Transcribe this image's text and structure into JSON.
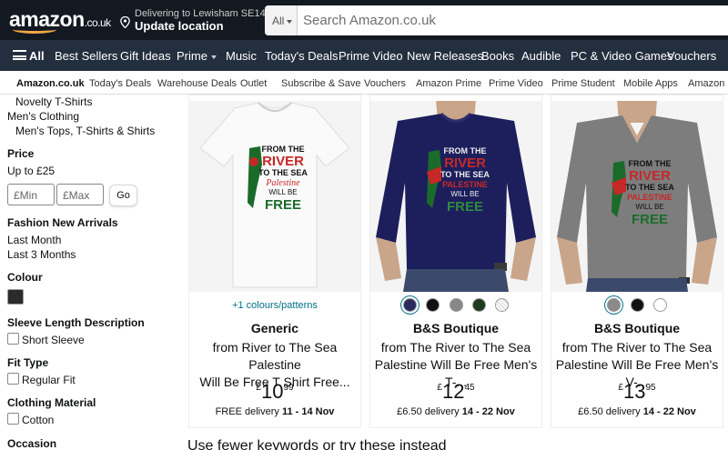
{
  "header": {
    "logo_text": "amazon",
    "logo_tld": ".co.uk",
    "deliver_line1": "Delivering to Lewisham SE14",
    "deliver_line2": "Update location",
    "search_category": "All",
    "search_placeholder": "Search Amazon.co.uk"
  },
  "nav": {
    "all_label": "All",
    "items": [
      "Best Sellers",
      "Gift Ideas",
      "Prime",
      "Music",
      "Today's Deals",
      "Prime Video",
      "New Releases",
      "Books",
      "Audible",
      "PC & Video Games",
      "Vouchers"
    ]
  },
  "subnav": {
    "items": [
      "Amazon.co.uk",
      "Today's Deals",
      "Warehouse Deals",
      "Outlet",
      "Subscribe & Save",
      "Vouchers",
      "Amazon Prime",
      "Prime Video",
      "Prime Student",
      "Mobile Apps",
      "Amazon P"
    ]
  },
  "sidebar": {
    "cat_novelty": "Novelty T-Shirts",
    "cat_clothing": "Men's Clothing",
    "cat_tops": "Men's Tops, T-Shirts & Shirts",
    "price_head": "Price",
    "price_upto": "Up to £25",
    "min_placeholder": "£Min",
    "max_placeholder": "£Max",
    "go_label": "Go",
    "fashion_head": "Fashion New Arrivals",
    "last_month": "Last Month",
    "last_3_months": "Last 3 Months",
    "colour_head": "Colour",
    "sleeve_head": "Sleeve Length Description",
    "short_sleeve": "Short Sleeve",
    "fit_head": "Fit Type",
    "regular_fit": "Regular Fit",
    "material_head": "Clothing Material",
    "cotton": "Cotton",
    "occasion_head": "Occasion"
  },
  "products": [
    {
      "colours_link": "+1 colours/patterns",
      "brand": "Generic",
      "title_l1": "from River to The Sea Palestine",
      "title_l2": "Will Be Free T Shirt Free...",
      "price_symbol": "£",
      "price_whole": "10",
      "price_fraction": "99",
      "delivery_text": "FREE delivery ",
      "delivery_dates": "11 - 14 Nov",
      "shirt_color": "#f7f7f7",
      "print_lines": [
        "FROM THE",
        "RIVER",
        "TO THE SEA",
        "Palestine",
        "WILL BE",
        "FREE"
      ]
    },
    {
      "brand": "B&S Boutique",
      "title_l1": "from The River to The Sea",
      "title_l2": "Palestine Will Be Free Men's T-...",
      "price_symbol": "£",
      "price_whole": "12",
      "price_fraction": "45",
      "delivery_text": "£6.50 delivery ",
      "delivery_dates": "14 - 22 Nov",
      "shirt_color": "#1d1f5c",
      "swatch_colors": [
        "#2a2a5e",
        "#111111",
        "#888888",
        "#1f3a1f",
        "#ffffff"
      ],
      "print_lines": [
        "FROM THE",
        "RIVER",
        "TO THE SEA",
        "PALESTINE",
        "WILL BE",
        "FREE"
      ]
    },
    {
      "brand": "B&S Boutique",
      "title_l1": "from The River to The Sea",
      "title_l2": "Palestine Will Be Free Men's V-...",
      "price_symbol": "£",
      "price_whole": "13",
      "price_fraction": "95",
      "delivery_text": "£6.50 delivery ",
      "delivery_dates": "14 - 22 Nov",
      "shirt_color": "#7d7d7d",
      "swatch_colors": [
        "#8a8a8a",
        "#111111",
        "#ffffff"
      ],
      "print_lines": [
        "FROM THE",
        "RIVER",
        "TO THE SEA",
        "PALESTINE",
        "WILL BE",
        "FREE"
      ]
    }
  ],
  "bottom_text": "Use fewer keywords or try these instead",
  "colors": {
    "header_bg": "#131921",
    "nav_bg": "#232f3e",
    "link": "#007185",
    "accent": "#f3a847"
  }
}
